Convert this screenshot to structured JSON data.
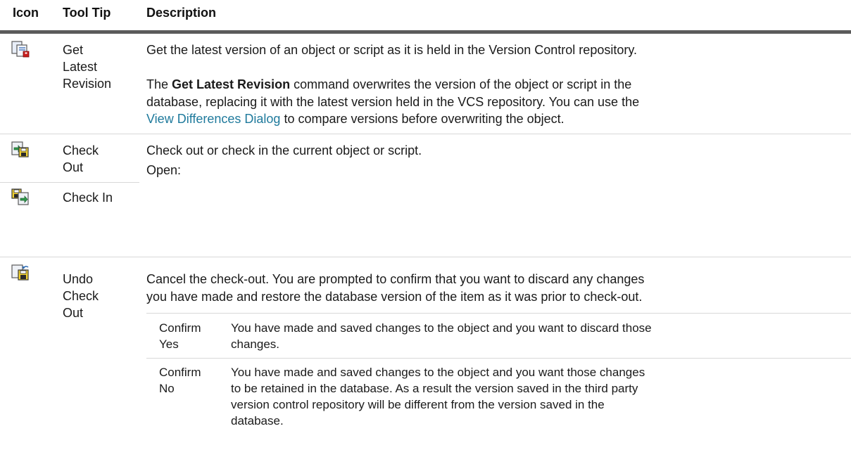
{
  "header": {
    "icon": "Icon",
    "tooltip": "Tool Tip",
    "description": "Description"
  },
  "rows": {
    "get_latest": {
      "icon": "get-latest-revision-icon",
      "tooltip": [
        "Get",
        "Latest",
        "Revision"
      ],
      "desc1": "Get the latest version of an object or script as it is held in the Version Control repository.",
      "desc2_pre": "The ",
      "desc2_bold": "Get Latest Revision",
      "desc2_line1_rest": " command overwrites the version of the object or script in the",
      "desc2_line2": "database, replacing it with the latest version held in the VCS repository. You can use the",
      "desc2_link": "View Differences Dialog",
      "desc2_line3_rest": " to compare versions before overwriting the object."
    },
    "check_out": {
      "icon": "check-out-icon",
      "tooltip": [
        "Check",
        "Out"
      ],
      "desc1": "Check out or check in the current object or script.",
      "desc2": "Open:"
    },
    "check_in": {
      "icon": "check-in-icon",
      "tooltip": "Check In"
    },
    "undo": {
      "icon": "undo-check-out-icon",
      "tooltip": [
        "Undo",
        "Check",
        "Out"
      ],
      "desc_lines": [
        "Cancel the check-out. You are prompted to confirm that you want to discard any changes",
        "you have made and restore the database version of the item as it was prior to check-out."
      ],
      "subtable": [
        {
          "label": [
            "Confirm",
            "Yes"
          ],
          "lines": [
            "You have made and saved changes to the object and you want to discard those",
            "changes."
          ]
        },
        {
          "label": [
            "Confirm",
            "No"
          ],
          "lines": [
            "You have made and saved changes to the object and you want those changes",
            "to be retained in the database. As a result the version saved in the third party",
            "version control repository will be different from the version saved in the",
            "database."
          ]
        }
      ]
    }
  }
}
